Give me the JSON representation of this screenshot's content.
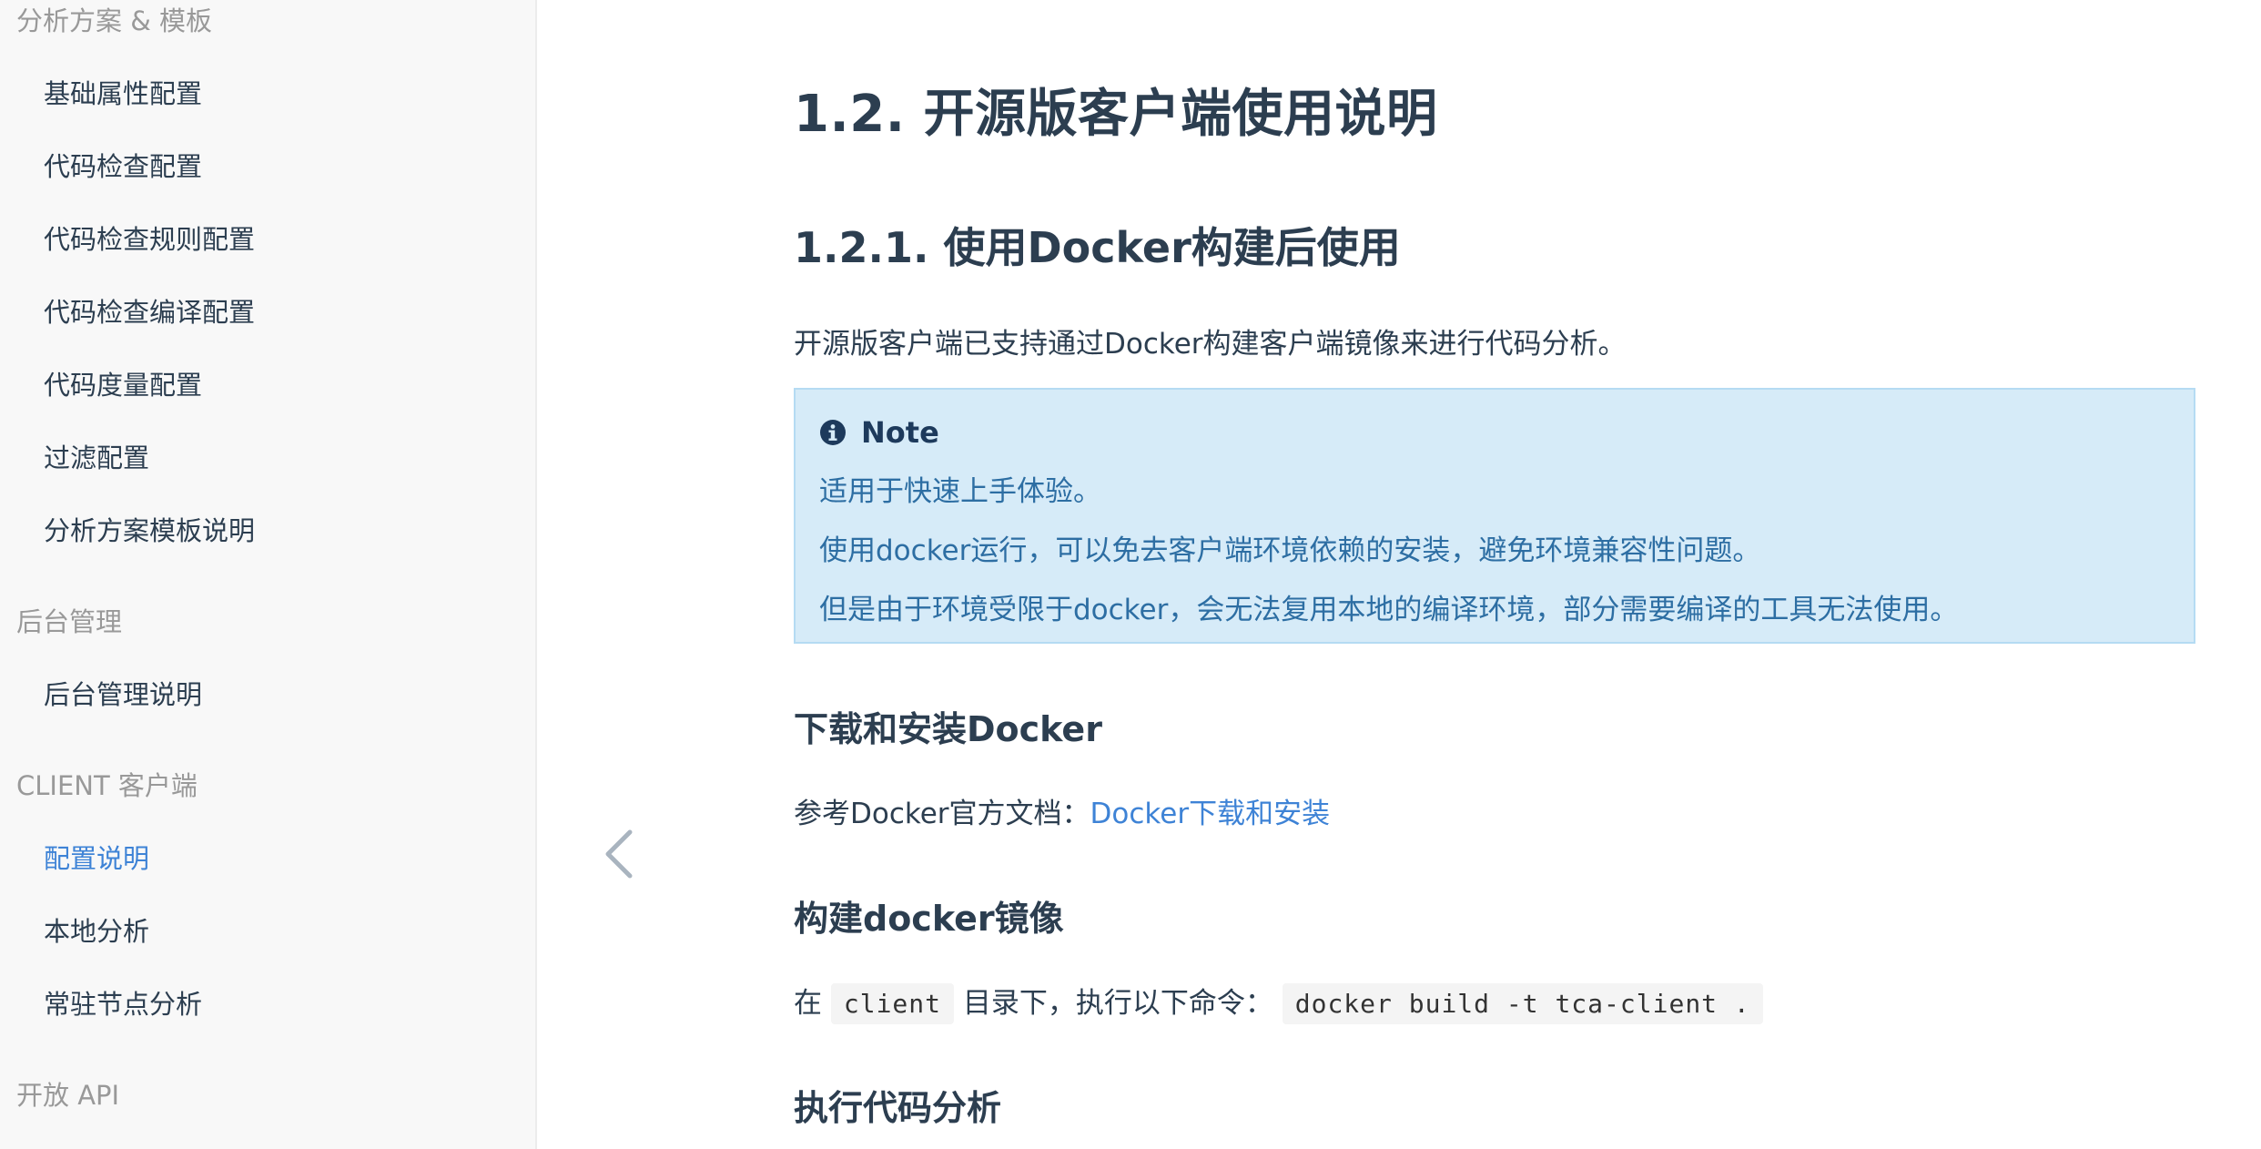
{
  "sidebar": {
    "groups": [
      {
        "label": "分析方案 & 模板"
      },
      {
        "label": "后台管理"
      },
      {
        "label": "CLIENT 客户端"
      },
      {
        "label": "开放 API"
      }
    ],
    "items": [
      {
        "label": "基础属性配置"
      },
      {
        "label": "代码检查配置"
      },
      {
        "label": "代码检查规则配置"
      },
      {
        "label": "代码检查编译配置"
      },
      {
        "label": "代码度量配置"
      },
      {
        "label": "过滤配置"
      },
      {
        "label": "分析方案模板说明"
      },
      {
        "label": "后台管理说明"
      },
      {
        "label": "配置说明"
      },
      {
        "label": "本地分析"
      },
      {
        "label": "常驻节点分析"
      }
    ],
    "active_item": "配置说明",
    "active_color": "#3e83d6"
  },
  "content": {
    "h1": "1.2. 开源版客户端使用说明",
    "h2": "1.2.1. 使用Docker构建后使用",
    "intro": "开源版客户端已支持通过Docker构建客户端镜像来进行代码分析。",
    "note": {
      "title": "Note",
      "icon": "info-circle-icon",
      "lines": [
        "适用于快速上手体验。",
        "使用docker运行，可以免去客户端环境依赖的安装，避免环境兼容性问题。",
        "但是由于环境受限于docker，会无法复用本地的编译环境，部分需要编译的工具无法使用。"
      ],
      "background": "#d6ebf8"
    },
    "section_download": {
      "title": "下载和安装Docker",
      "text_prefix": "参考Docker官方文档：",
      "link_text": "Docker下载和安装"
    },
    "section_build": {
      "title": "构建docker镜像",
      "text_1": "在",
      "code_1": "client",
      "text_2": "目录下，执行以下命令：",
      "code_2": "docker build -t tca-client ."
    },
    "section_run": {
      "title": "执行代码分析"
    }
  },
  "nav": {
    "prev_icon": "chevron-left-icon"
  }
}
